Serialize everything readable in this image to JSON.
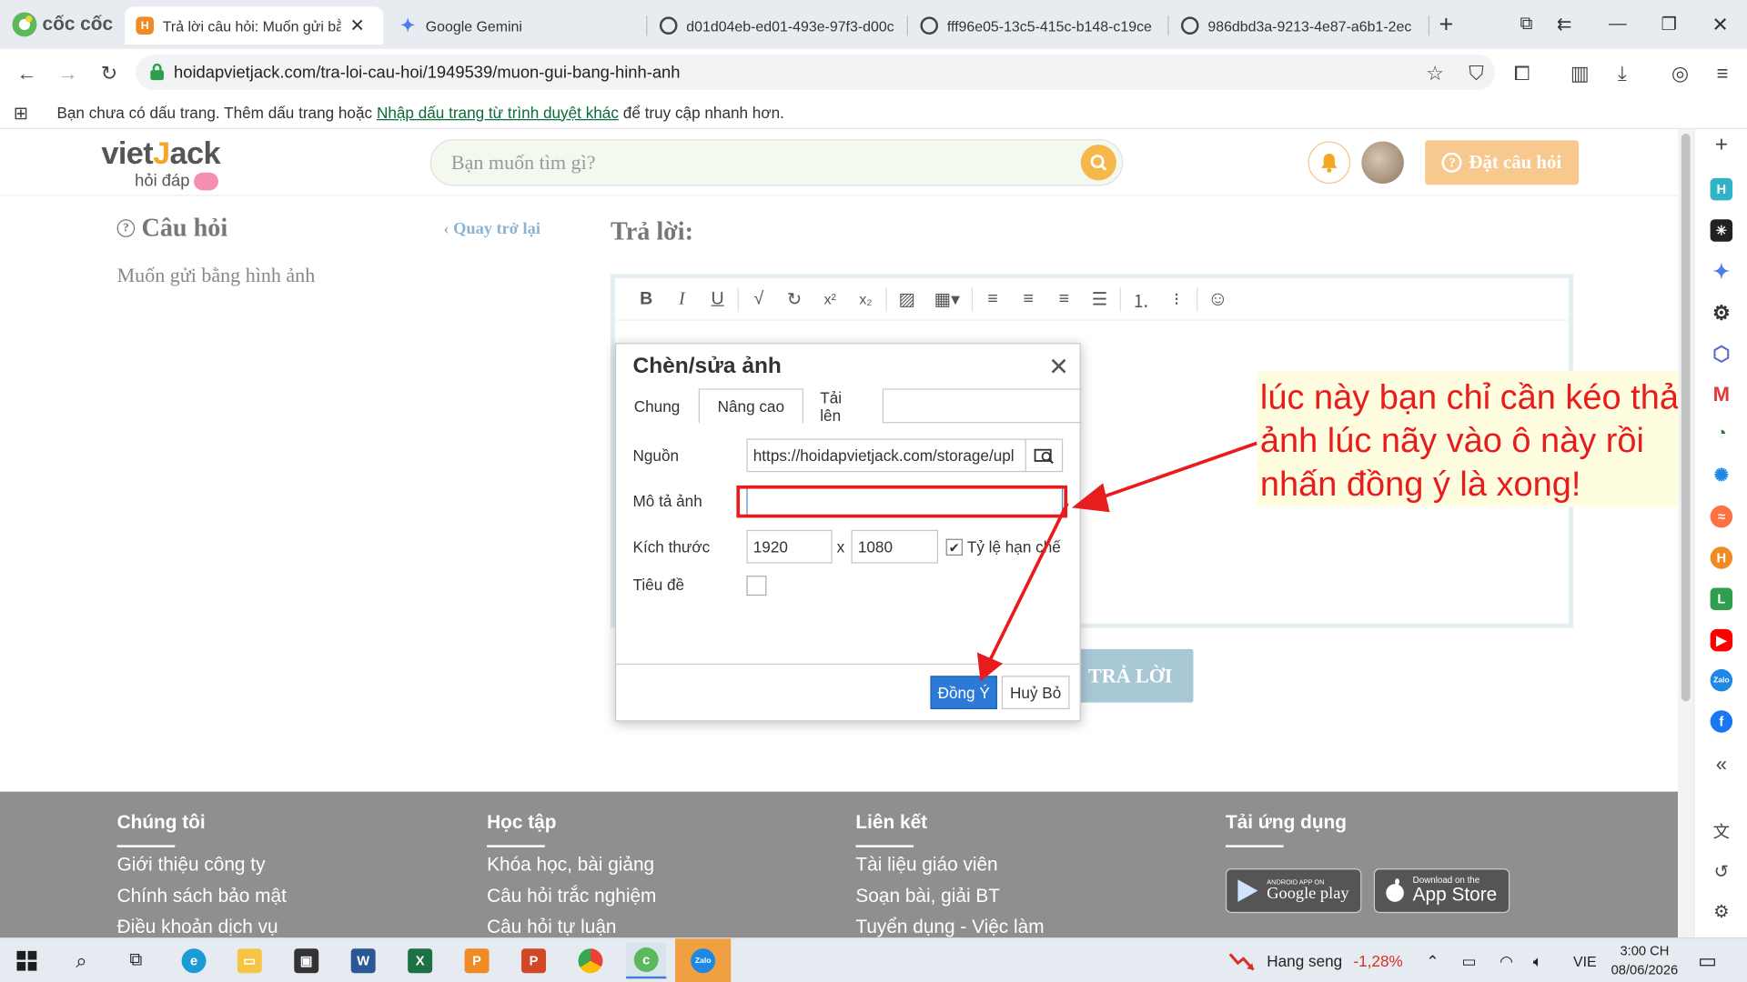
{
  "browser": {
    "tabs": [
      {
        "title": "Trả lời câu hỏi: Muốn gửi bằng hình ảnh"
      },
      {
        "title": "Google Gemini"
      },
      {
        "title": "d01d04eb-ed01-493e-97f3-d00c"
      },
      {
        "title": "fff96e05-13c5-415c-b148-c19ce"
      },
      {
        "title": "986dbd3a-9213-4e87-a6b1-2ec"
      }
    ],
    "brand": "cốc cốc",
    "url": "hoidapvietjack.com/tra-loi-cau-hoi/1949539/muon-gui-bang-hinh-anh",
    "bookmark_text_before": "Bạn chưa có dấu trang. Thêm dấu trang hoặc",
    "bookmark_link": "Nhập dấu trang từ trình duyệt khác",
    "bookmark_text_after": "để truy cập nhanh hơn."
  },
  "site": {
    "logo_main_a": "viet",
    "logo_main_b": "J",
    "logo_main_c": "ack",
    "logo_sub": "hỏi đáp",
    "search_placeholder": "Bạn muốn tìm gì?",
    "ask_button": "Đặt câu hỏi",
    "question_heading": "Câu hỏi",
    "back_link": "Quay trở lại",
    "question_text": "Muốn gửi bằng hình ảnh",
    "answer_heading": "Trả lời:",
    "submit_button": "TRẢ LỜI"
  },
  "dialog": {
    "title": "Chèn/sửa ảnh",
    "tabs": [
      "Chung",
      "Nâng cao",
      "Tải lên"
    ],
    "source_label": "Nguồn",
    "source_value": "https://hoidapvietjack.com/storage/upl",
    "alt_label": "Mô tả ảnh",
    "alt_value": "",
    "size_label": "Kích thước",
    "width_value": "1920",
    "size_separator": "x",
    "height_value": "1080",
    "ratio_label": "Tỷ lệ hạn chế",
    "ratio_checked": true,
    "title_label": "Tiêu đề",
    "ok_button": "Đồng Ý",
    "cancel_button": "Huỷ Bỏ"
  },
  "annotation": {
    "text": "lúc này bạn chỉ cần kéo thả ảnh lúc nãy vào ô này rồi nhấn đồng ý là xong!",
    "color": "#e81c1c"
  },
  "footer": {
    "columns": [
      {
        "heading": "Chúng tôi",
        "links": [
          "Giới thiệu công ty",
          "Chính sách bảo mật",
          "Điều khoản dịch vụ"
        ]
      },
      {
        "heading": "Học tập",
        "links": [
          "Khóa học, bài giảng",
          "Câu hỏi trắc nghiệm",
          "Câu hỏi tự luận"
        ]
      },
      {
        "heading": "Liên kết",
        "links": [
          "Tài liệu giáo viên",
          "Soạn bài, giải BT",
          "Tuyển dụng - Việc làm"
        ]
      },
      {
        "heading": "Tải ứng dụng",
        "links": []
      }
    ],
    "google_play_small": "ANDROID APP ON",
    "google_play": "Google play",
    "app_store_small": "Download on the",
    "app_store": "App Store"
  },
  "taskbar": {
    "stock_name": "Hang seng",
    "stock_change": "-1,28%",
    "language": "VIE",
    "time": "3:00 CH",
    "date": "08/06/2026"
  }
}
